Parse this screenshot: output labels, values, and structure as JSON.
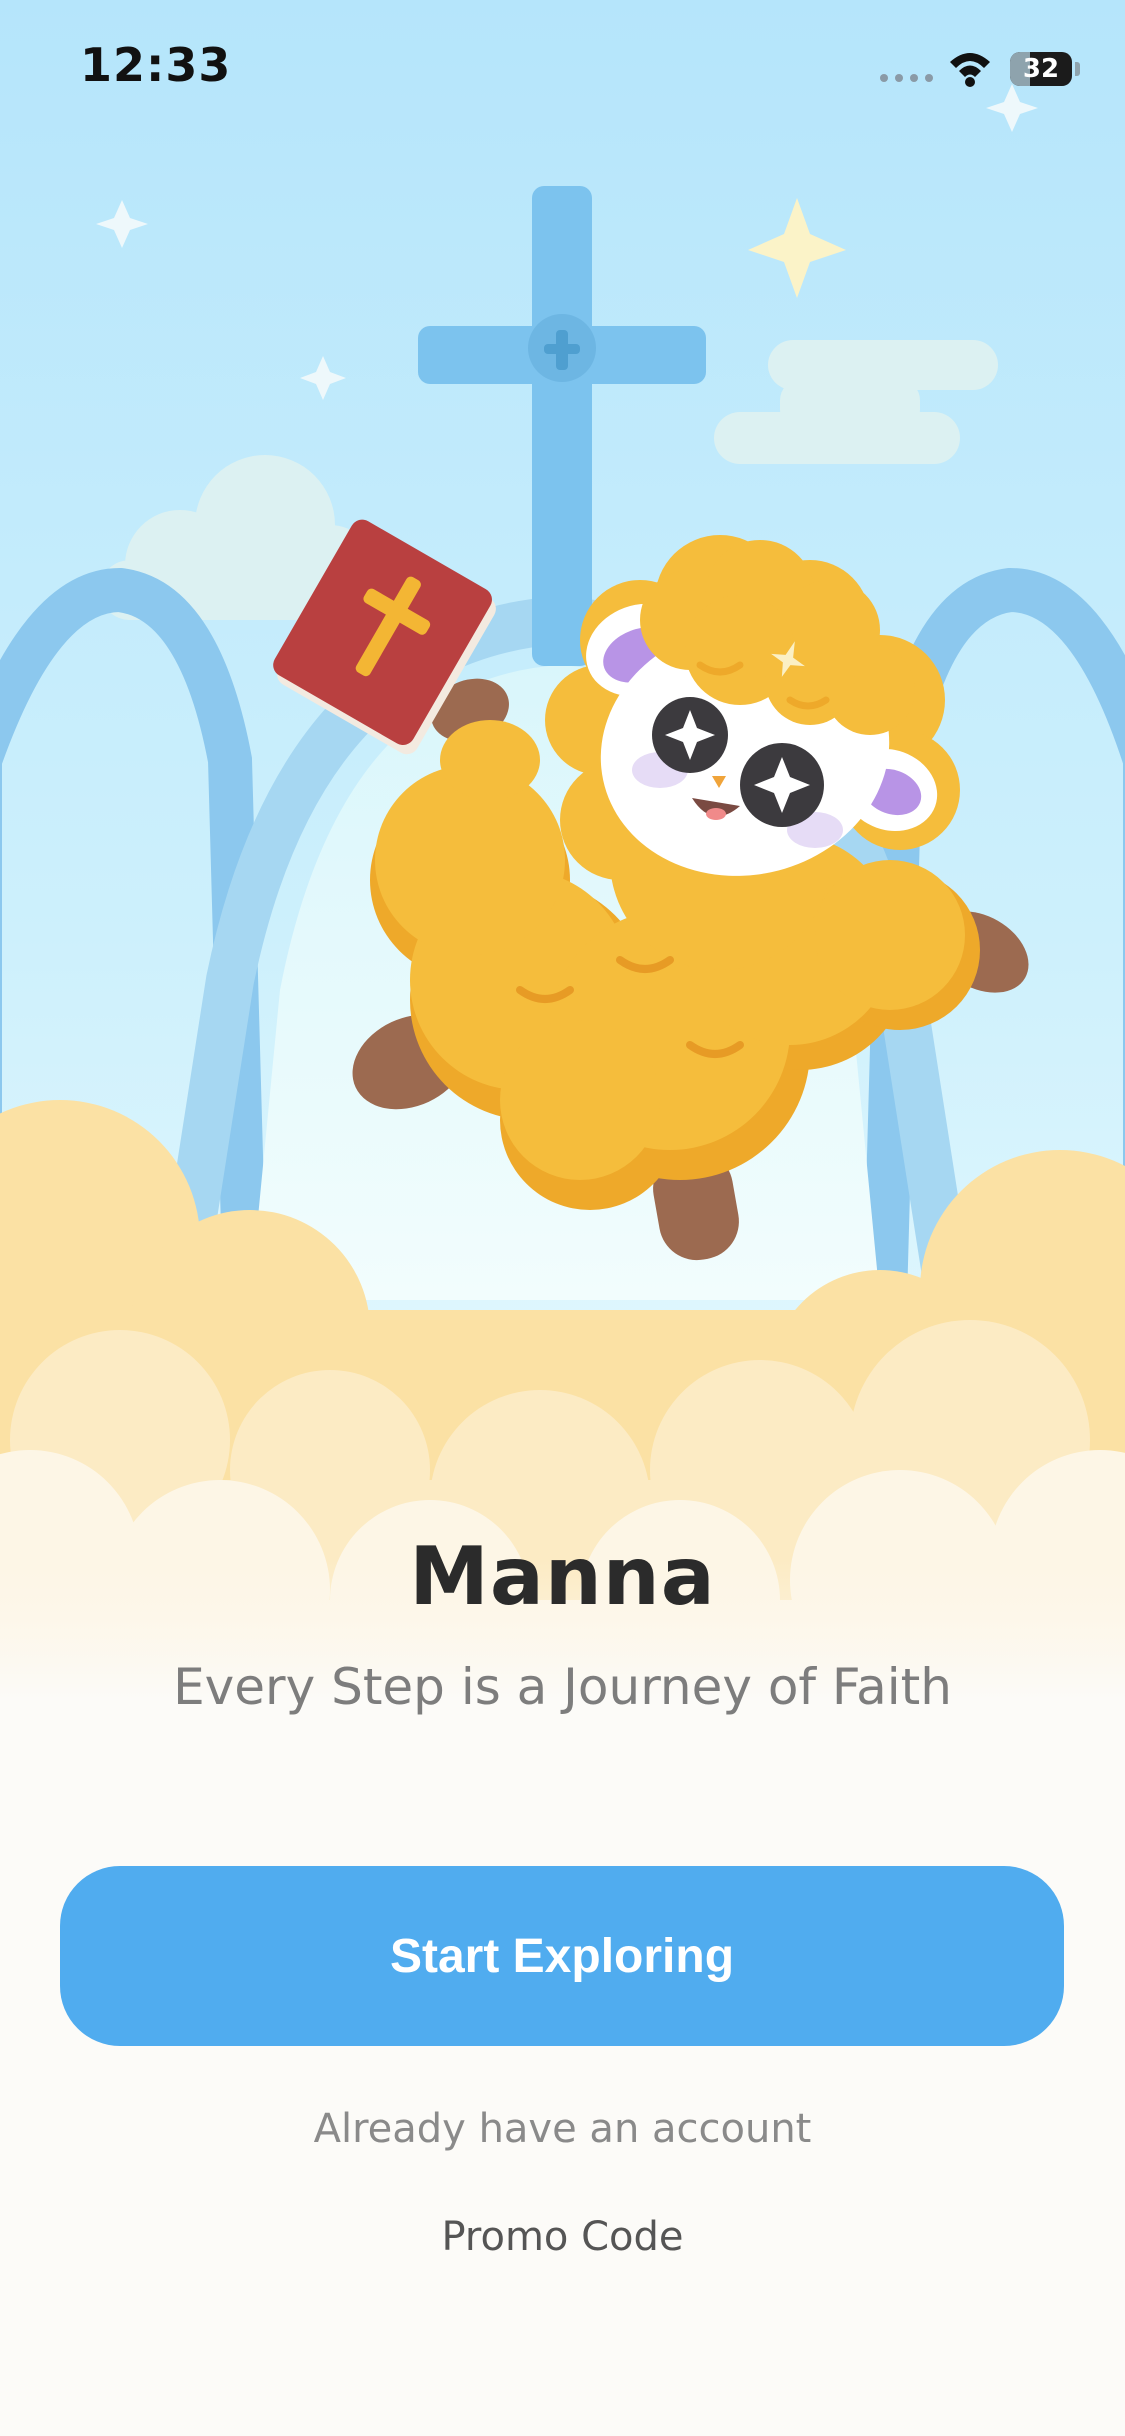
{
  "status_bar": {
    "time": "12:33",
    "battery_level": "32"
  },
  "hero": {
    "illustration_icons": [
      "sheep-mascot-icon",
      "bible-icon",
      "cross-icon",
      "sparkle-icon",
      "cloud-icon"
    ],
    "colors": {
      "sky_top": "#b5e5fb",
      "sky_bottom": "#e9fbff",
      "cross": "#7cc3ee",
      "arch": "#8cc8ee",
      "sheep_wool": "#f5bd3c",
      "sheep_wool_shadow": "#eea92a",
      "sheep_legs": "#9c6a50",
      "bible": "#b94040",
      "bible_cross": "#f3b634",
      "cloud_warm": "#fbe1a4",
      "cloud_light": "#fdf6e6"
    }
  },
  "content": {
    "title": "Manna",
    "tagline": "Every Step is a Journey of Faith",
    "start_button_label": "Start Exploring",
    "login_link": "Already have an account",
    "promo_link": "Promo Code"
  },
  "theme": {
    "accent": "#50acef",
    "background": "#fcfbf8"
  }
}
